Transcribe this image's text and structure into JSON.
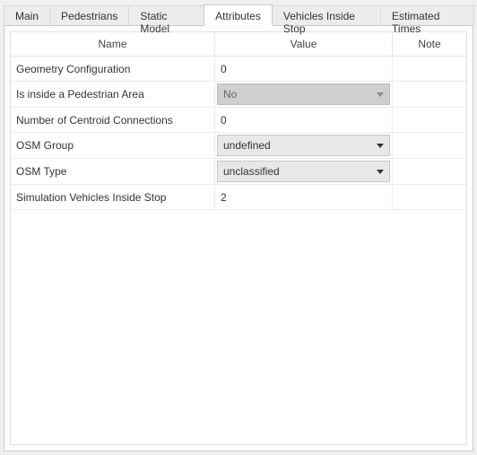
{
  "tabs": [
    {
      "label": "Main",
      "active": false
    },
    {
      "label": "Pedestrians",
      "active": false
    },
    {
      "label": "Static Model",
      "active": false
    },
    {
      "label": "Attributes",
      "active": true
    },
    {
      "label": "Vehicles Inside Stop",
      "active": false
    },
    {
      "label": "Estimated Times",
      "active": false
    }
  ],
  "columns": {
    "name": "Name",
    "value": "Value",
    "note": "Note"
  },
  "rows": [
    {
      "name": "Geometry Configuration",
      "type": "text",
      "value": "0",
      "note": ""
    },
    {
      "name": "Is inside a Pedestrian Area",
      "type": "dropdown",
      "value": "No",
      "note": "",
      "disabled": true
    },
    {
      "name": "Number of Centroid Connections",
      "type": "text",
      "value": "0",
      "note": ""
    },
    {
      "name": "OSM Group",
      "type": "dropdown",
      "value": "undefined",
      "note": "",
      "disabled": false
    },
    {
      "name": "OSM Type",
      "type": "dropdown",
      "value": "unclassified",
      "note": "",
      "disabled": false
    },
    {
      "name": "Simulation Vehicles Inside Stop",
      "type": "text",
      "value": "2",
      "note": ""
    }
  ]
}
